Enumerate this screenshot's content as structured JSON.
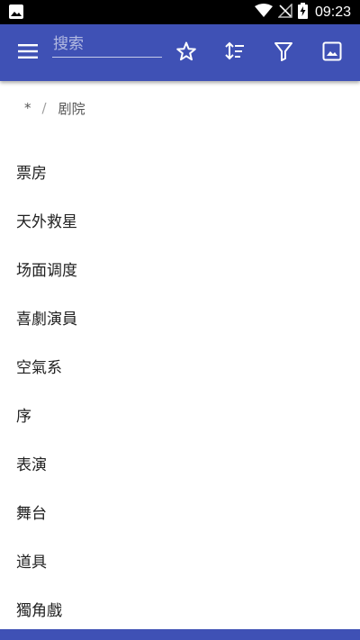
{
  "status_bar": {
    "time": "09:23",
    "icons": [
      "image-icon",
      "wifi-icon",
      "no-signal-icon",
      "battery-charging-icon"
    ]
  },
  "toolbar": {
    "search_placeholder": "搜索",
    "search_value": "",
    "icons": [
      "menu-icon",
      "star-icon",
      "sort-icon",
      "filter-icon",
      "image-icon"
    ],
    "color": "#3f51b5"
  },
  "breadcrumb": {
    "root": "*",
    "separator": "/",
    "current": "剧院"
  },
  "list": {
    "items": [
      {
        "label": "票房"
      },
      {
        "label": "天外救星"
      },
      {
        "label": "场面调度"
      },
      {
        "label": "喜劇演員"
      },
      {
        "label": "空氣系"
      },
      {
        "label": "序"
      },
      {
        "label": "表演"
      },
      {
        "label": "舞台"
      },
      {
        "label": "道具"
      },
      {
        "label": "獨角戲"
      }
    ]
  }
}
